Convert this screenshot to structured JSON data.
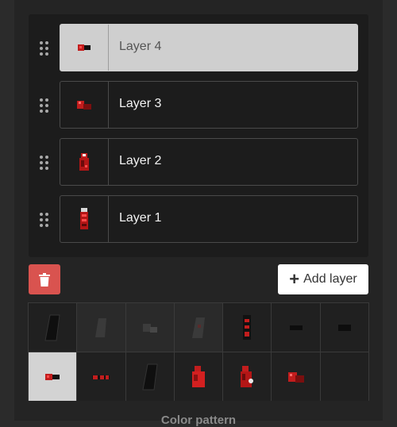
{
  "layers": [
    {
      "label": "Layer 4",
      "selected": true,
      "icon": "layer-4-thumbnail-icon"
    },
    {
      "label": "Layer 3",
      "selected": false,
      "icon": "layer-3-thumbnail-icon"
    },
    {
      "label": "Layer 2",
      "selected": false,
      "icon": "layer-2-thumbnail-icon"
    },
    {
      "label": "Layer 1",
      "selected": false,
      "icon": "layer-1-thumbnail-icon"
    }
  ],
  "actions": {
    "delete_icon": "trash-icon",
    "add_layer_label": "Add layer",
    "add_icon": "plus-icon"
  },
  "patterns": {
    "rows": 2,
    "columns": 7,
    "selected_index": 7,
    "cell_count": 14
  },
  "section": {
    "title": "Color pattern"
  },
  "colors": {
    "accent_red": "#d9534f",
    "selected_bg": "#cfcfcf",
    "panel_bg": "#1c1c1c"
  }
}
